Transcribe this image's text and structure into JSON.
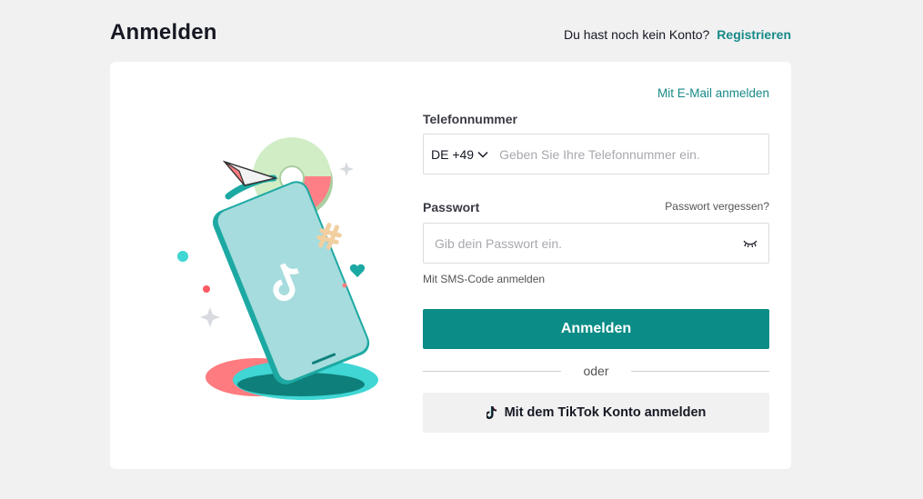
{
  "header": {
    "title": "Anmelden",
    "signup_question": "Du hast noch kein Konto?",
    "signup_link": "Registrieren"
  },
  "form": {
    "email_login_link": "Mit E-Mail anmelden",
    "phone": {
      "label": "Telefonnummer",
      "country_code": "DE +49",
      "placeholder": "Geben Sie Ihre Telefonnummer ein.",
      "value": ""
    },
    "password": {
      "label": "Passwort",
      "forgot_link": "Passwort vergessen?",
      "placeholder": "Gib dein Passwort ein.",
      "value": ""
    },
    "sms_link": "Mit SMS-Code anmelden",
    "submit_label": "Anmelden",
    "divider_text": "oder",
    "tiktok_button_label": "Mit dem TikTok Konto anmelden"
  },
  "icons": {
    "country_dropdown": "chevron-down-icon",
    "password_visibility": "eye-closed-icon",
    "tiktok_logo": "tiktok-logo-icon",
    "illustration": "phone-login-illustration"
  },
  "colors": {
    "accent": "#0b8c87",
    "link": "#168a87",
    "background": "#f1f1f2",
    "card": "#ffffff"
  }
}
